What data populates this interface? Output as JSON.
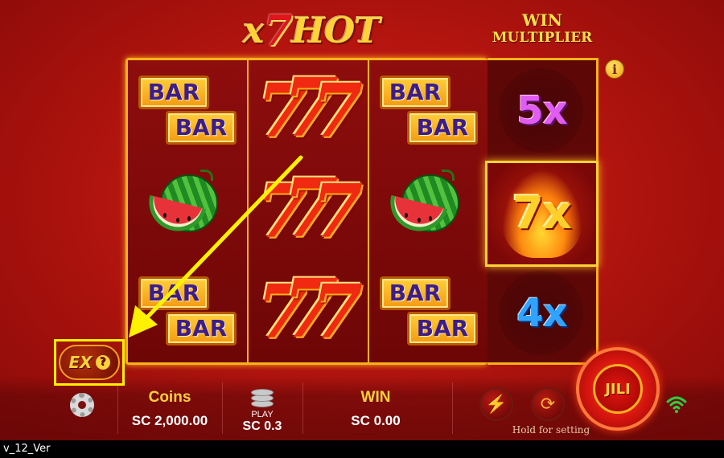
{
  "game": {
    "logo_prefix": "x",
    "logo_seven": "7",
    "logo_suffix": "HOT"
  },
  "multiplier_panel": {
    "title_line1": "WIN",
    "title_line2": "MULTIPLIER",
    "info_label": "i",
    "values": [
      "5x",
      "7x",
      "4x"
    ],
    "active_index": 1
  },
  "reels": [
    [
      "bar-bar",
      "watermelon",
      "bar-bar"
    ],
    [
      "seven-seven-seven",
      "seven-seven-seven",
      "seven-seven-seven"
    ],
    [
      "bar-bar",
      "watermelon",
      "bar-bar"
    ]
  ],
  "symbol_text": {
    "bar": "BAR",
    "seven": "7"
  },
  "extra_bet": {
    "label": "EX",
    "help": "?"
  },
  "bottom_bar": {
    "coins_label": "Coins",
    "coins_value": "SC 2,000.00",
    "play_label": "PLAY",
    "play_value": "SC 0.3",
    "win_label": "WIN",
    "win_value": "SC 0.00",
    "turbo_icon": "lightning-icon",
    "autoplay_icon": "autoplay-icon",
    "hold_text": "Hold for setting",
    "spin_label": "JILI",
    "connection_icon": "wifi-icon"
  },
  "footer": {
    "version": "v_12_Ver"
  },
  "colors": {
    "accent_gold": "#ffd23a",
    "background_red": "#b5150f",
    "annotation_yellow": "#fff200"
  }
}
